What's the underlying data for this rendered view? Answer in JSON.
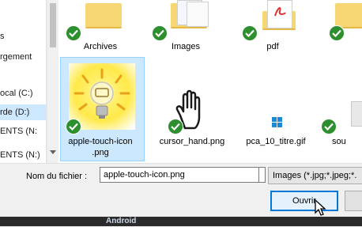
{
  "nav": {
    "items": [
      {
        "label": "s"
      },
      {
        "label": "rgement"
      },
      {
        "label": "ocal (C:)"
      },
      {
        "label": "rde (D:)"
      },
      {
        "label": "ENTS (N:"
      },
      {
        "label": "ENTS (N:)"
      }
    ]
  },
  "files": [
    {
      "label": "Archives",
      "icon": "folder-icon"
    },
    {
      "label": "Images",
      "icon": "folder-icon"
    },
    {
      "label": "pdf",
      "icon": "folder-icon"
    },
    {
      "label": "apple-touch-icon\n.png",
      "icon": "lightbulb-image-icon",
      "selected": true
    },
    {
      "label": "cursor_hand.png",
      "icon": "hand-cursor-image-icon"
    },
    {
      "label": "pca_10_titre.gif",
      "icon": "gif-file-icon"
    },
    {
      "label": "sou",
      "icon": "folder-icon"
    }
  ],
  "bottom": {
    "filename_label": "Nom du fichier :",
    "filename_value": "apple-touch-icon.png",
    "filter_label": "Images (*.jpg;*.jpeg;*.",
    "open_label": "Ouvrir"
  },
  "taskbar": {
    "item_label": "Android"
  },
  "colors": {
    "selection": "#cce8ff",
    "check": "#2d8f2d",
    "primary_button_border": "#0078d7"
  }
}
